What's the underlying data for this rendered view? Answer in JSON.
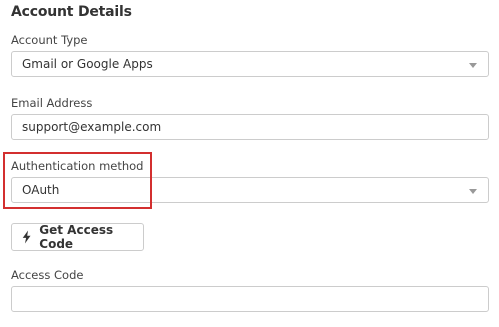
{
  "section": {
    "title": "Account Details"
  },
  "account_type": {
    "label": "Account Type",
    "value": "Gmail or Google Apps",
    "caret_icon": "caret-down-icon"
  },
  "email": {
    "label": "Email Address",
    "value": "support@example.com"
  },
  "auth": {
    "label": "Authentication method",
    "value": "OAuth",
    "caret_icon": "caret-down-icon",
    "highlight_color": "#d32f2f"
  },
  "get_code": {
    "label": "Get Access Code",
    "icon": "bolt-icon"
  },
  "access_code": {
    "label": "Access Code",
    "value": ""
  }
}
